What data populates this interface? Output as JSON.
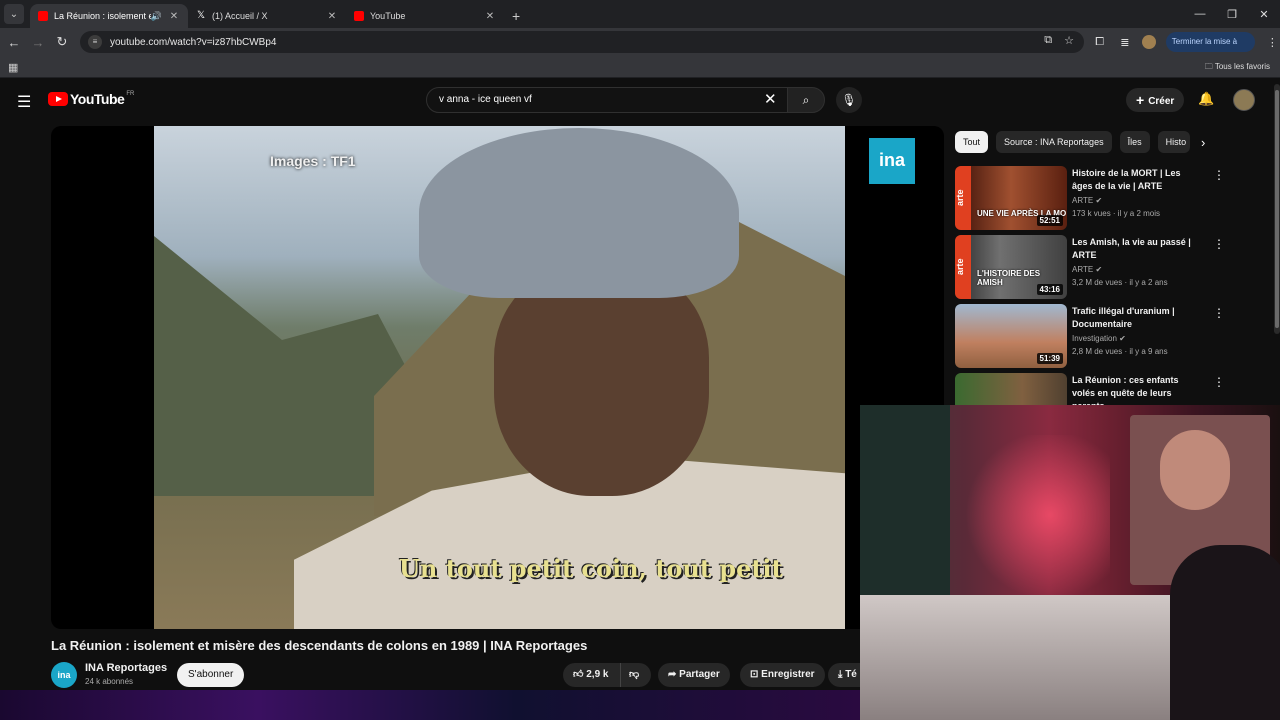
{
  "browser": {
    "tabs": [
      {
        "title": "La Réunion : isolement et m",
        "favicon": "youtube",
        "audio": true,
        "active": true
      },
      {
        "title": "(1) Accueil / X",
        "favicon": "x",
        "active": false
      },
      {
        "title": "YouTube",
        "favicon": "youtube",
        "active": false
      }
    ],
    "url": "youtube.com/watch?v=iz87hbCWBp4",
    "update_label": "Terminer la mise à jour",
    "all_favorites": "Tous les favoris"
  },
  "youtube": {
    "logo": "YouTube",
    "country": "FR",
    "search_value": "v anna - ice queen vf",
    "create_label": "Créer"
  },
  "video": {
    "watermark": "Images : TF1",
    "channel_logo": "ina",
    "subtitle": "Un tout petit coin, tout petit",
    "title": "La Réunion : isolement et misère des descendants de colons en 1989 | INA Reportages",
    "channel_name": "INA Reportages",
    "channel_avatar": "ina",
    "subscribers": "24 k abonnés",
    "subscribe_label": "S'abonner",
    "likes": "2,9 k",
    "share_label": "Partager",
    "save_label": "Enregistrer",
    "download_label": "Té"
  },
  "chips": [
    "Tout",
    "Source : INA Reportages",
    "Îles",
    "Histo"
  ],
  "recommendations": [
    {
      "title": "Histoire de la MORT | Les âges de la vie | ARTE",
      "channel": "ARTE",
      "meta": "173 k vues · il y a 2 mois",
      "duration": "52:51",
      "overlay": "UNE VIE APRÈS LA MO"
    },
    {
      "title": "Les Amish, la vie au passé | ARTE",
      "channel": "ARTE",
      "meta": "3,2 M de vues · il y a 2 ans",
      "duration": "43:16",
      "overlay": "L'HISTOIRE DES AMISH"
    },
    {
      "title": "Trafic illégal d'uranium | Documentaire",
      "channel": "Investigation",
      "meta": "2,8 M de vues · il y a 9 ans",
      "duration": "51:39",
      "overlay": ""
    },
    {
      "title": "La Réunion : ces enfants volés en quête de leurs parents",
      "channel": "",
      "meta": "",
      "duration": "",
      "overlay": ""
    }
  ],
  "colors": {
    "brand": "#ff0000",
    "bg": "#0f0f0f",
    "ina": "#1aa6c8",
    "update": "#1f3b64"
  }
}
